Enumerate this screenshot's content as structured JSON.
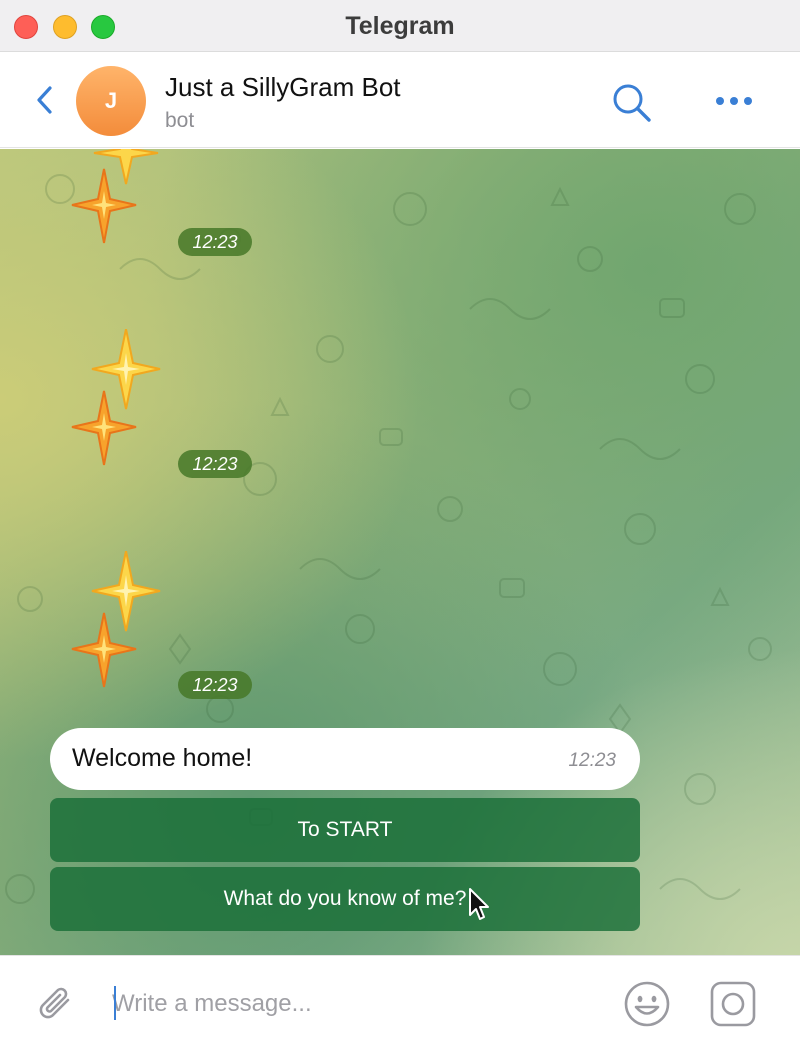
{
  "window": {
    "title": "Telegram"
  },
  "header": {
    "avatar_letter": "J",
    "chat_name": "Just a SillyGram Bot",
    "chat_status": "bot",
    "icons": {
      "back": "chevron-left-icon",
      "search": "search-icon",
      "more": "more-horizontal-icon"
    }
  },
  "messages": {
    "stickers": [
      {
        "emoji": "sparkles",
        "time": "12:23"
      },
      {
        "emoji": "sparkles",
        "time": "12:23"
      },
      {
        "emoji": "sparkles",
        "time": "12:23"
      }
    ],
    "text_message": {
      "text": "Welcome home!",
      "time": "12:23"
    },
    "inline_keyboard": [
      {
        "label": "To START"
      },
      {
        "label": "What do you know of me?"
      }
    ]
  },
  "composer": {
    "placeholder": "Write a message...",
    "value": "",
    "icons": {
      "attach": "paperclip-icon",
      "emoji": "emoji-smile-icon",
      "bot_commands": "bot-command-icon"
    }
  },
  "colors": {
    "accent": "#3a7fd5",
    "keyboard_button": "#1e6e37",
    "time_badge": "#467828"
  }
}
